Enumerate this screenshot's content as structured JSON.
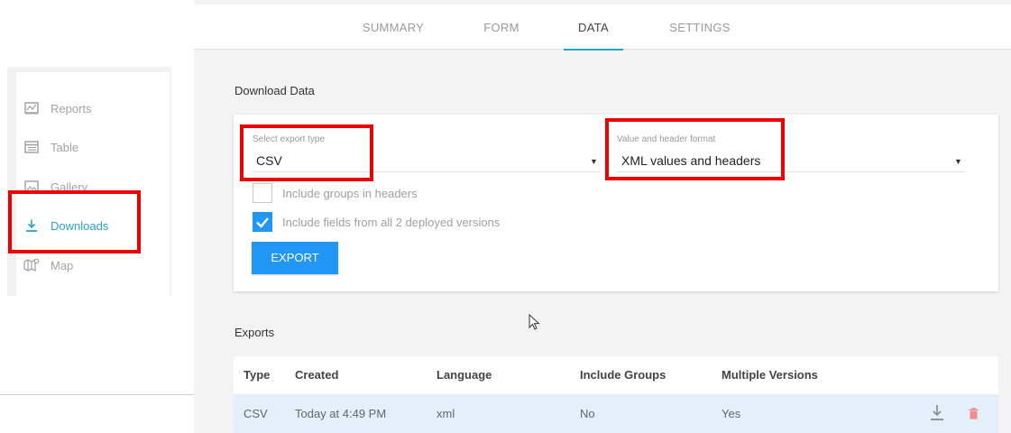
{
  "tabs": [
    {
      "label": "SUMMARY"
    },
    {
      "label": "FORM"
    },
    {
      "label": "DATA",
      "active": true
    },
    {
      "label": "SETTINGS"
    }
  ],
  "sidebar": {
    "items": [
      {
        "label": "Reports",
        "icon": "reports-icon"
      },
      {
        "label": "Table",
        "icon": "table-icon"
      },
      {
        "label": "Gallery",
        "icon": "gallery-icon"
      },
      {
        "label": "Downloads",
        "icon": "download-icon",
        "active": true
      },
      {
        "label": "Map",
        "icon": "map-icon"
      }
    ]
  },
  "download": {
    "title": "Download Data",
    "export_type": {
      "label": "Select export type",
      "value": "CSV"
    },
    "format": {
      "label": "Value and header format",
      "value": "XML values and headers"
    },
    "include_groups": {
      "label": "Include groups in headers",
      "checked": false
    },
    "include_fields": {
      "label": "Include fields from all 2 deployed versions",
      "checked": true
    },
    "export_button": "EXPORT"
  },
  "exports": {
    "title": "Exports",
    "columns": [
      "Type",
      "Created",
      "Language",
      "Include Groups",
      "Multiple Versions"
    ],
    "rows": [
      {
        "type": "CSV",
        "created": "Today at 4:49 PM",
        "language": "xml",
        "include_groups": "No",
        "multiple_versions": "Yes"
      }
    ]
  },
  "colors": {
    "accent": "#26a6c4",
    "button": "#2196f3",
    "highlight": "#ee0000",
    "row_bg": "#e3f0fc",
    "delete": "#f28b8b"
  }
}
